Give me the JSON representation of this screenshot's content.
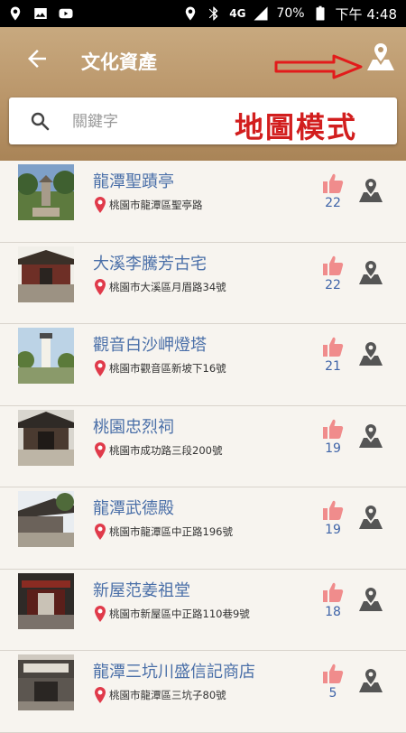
{
  "status_bar": {
    "network": "4G",
    "battery": "70%",
    "time": "下午 4:48"
  },
  "header": {
    "title": "文化資產",
    "map_mode_label": "地圖模式"
  },
  "search": {
    "placeholder": "關鍵字"
  },
  "colors": {
    "header_brown": "#b99569",
    "link_blue": "#4a6fa8",
    "pin_red": "#e03a4a",
    "like_pink": "#f08c8c",
    "label_red": "#d21e1e"
  },
  "items": [
    {
      "name": "龍潭聖蹟亭",
      "address": "桃園市龍潭區聖亭路",
      "likes": "22"
    },
    {
      "name": "大溪李騰芳古宅",
      "address": "桃園市大溪區月眉路34號",
      "likes": "22"
    },
    {
      "name": "觀音白沙岬燈塔",
      "address": "桃園市觀音區新坡下16號",
      "likes": "21"
    },
    {
      "name": "桃園忠烈祠",
      "address": "桃園市成功路三段200號",
      "likes": "19"
    },
    {
      "name": "龍潭武德殿",
      "address": "桃園市龍潭區中正路196號",
      "likes": "19"
    },
    {
      "name": "新屋范姜祖堂",
      "address": "桃園市新屋區中正路110巷9號",
      "likes": "18"
    },
    {
      "name": "龍潭三坑川盛信記商店",
      "address": "桃園市龍潭區三坑子80號",
      "likes": "5"
    }
  ]
}
